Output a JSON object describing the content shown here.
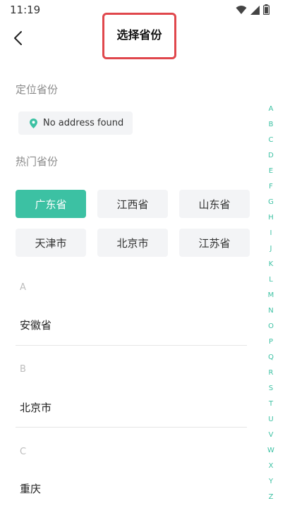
{
  "status": {
    "time": "11:19"
  },
  "header": {
    "title": "选择省份"
  },
  "location": {
    "label": "定位省份",
    "chip_text": "No address found"
  },
  "hot": {
    "label": "热门省份",
    "provinces": [
      "广东省",
      "江西省",
      "山东省",
      "天津市",
      "北京市",
      "江苏省"
    ],
    "selected": "广东省"
  },
  "groups": [
    {
      "letter": "A",
      "items": [
        "安徽省"
      ]
    },
    {
      "letter": "B",
      "items": [
        "北京市"
      ]
    },
    {
      "letter": "C",
      "items": [
        "重庆"
      ]
    }
  ],
  "index_letters": [
    "A",
    "B",
    "C",
    "D",
    "E",
    "F",
    "G",
    "H",
    "I",
    "J",
    "K",
    "L",
    "M",
    "N",
    "O",
    "P",
    "Q",
    "R",
    "S",
    "T",
    "U",
    "V",
    "W",
    "X",
    "Y",
    "Z"
  ],
  "colors": {
    "accent": "#3cc1a3",
    "highlight_box": "#e0474c"
  }
}
